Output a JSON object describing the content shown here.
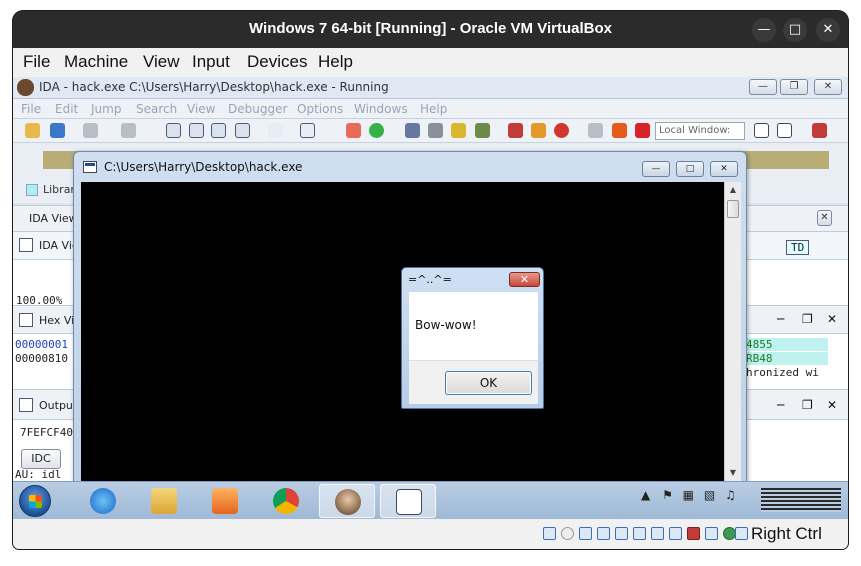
{
  "vbox": {
    "title": "Windows 7 64-bit [Running] - Oracle VM VirtualBox",
    "menu": [
      "File",
      "Machine",
      "View",
      "Input",
      "Devices",
      "Help"
    ],
    "host_key": "Right Ctrl"
  },
  "ida": {
    "title": "IDA - hack.exe C:\\Users\\Harry\\Desktop\\hack.exe - Running",
    "menu": [
      "File",
      "Edit",
      "Jump",
      "Search",
      "View",
      "Debugger",
      "Options",
      "Windows",
      "Help"
    ],
    "debugger_combo": "Local Window:",
    "legend_label": "Librar",
    "panes": {
      "ida_view_tab": "IDA View",
      "ida_view_pane": "IDA Vie",
      "zoom": "100.00%",
      "hex_view": "Hex Vie",
      "hex_line1": "00000001",
      "hex_line2": "00000810",
      "output": "Output",
      "output_line": "7FEFCF40",
      "idc_button": "IDC",
      "status": "AU:  idl",
      "right_hex1": "4855",
      "right_hex2": "RB48",
      "right_sync": "hronized wi",
      "right_td": "TD"
    }
  },
  "console": {
    "title": "C:\\Users\\Harry\\Desktop\\hack.exe"
  },
  "msgbox": {
    "title": "=^..^=",
    "message": "Bow-wow!",
    "ok_label": "OK"
  },
  "colors": {
    "host_titlebar": "#2b2b2b",
    "console_bg": "#000000",
    "taskbar": "#b9cde3",
    "msgbox_close": "#c9473a",
    "ok_border": "#3c7fb1"
  }
}
